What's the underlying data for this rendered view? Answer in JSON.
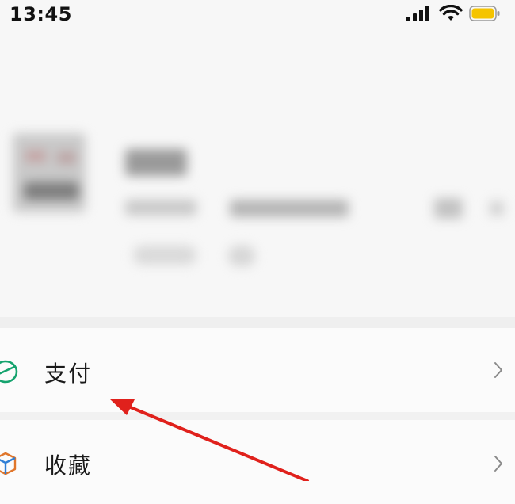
{
  "status_bar": {
    "time": "13:45",
    "signal_icon": "cellular-signal-icon",
    "wifi_icon": "wifi-icon",
    "battery_icon": "battery-icon",
    "battery_color": "#f5c400"
  },
  "menu": {
    "items": [
      {
        "label": "支付",
        "icon": "pay-icon",
        "icon_color": "#15a36e"
      },
      {
        "label": "收藏",
        "icon": "favorites-cube-icon",
        "icon_color": "#e0762b"
      }
    ]
  },
  "annotation": {
    "arrow_color": "#e0211c"
  }
}
